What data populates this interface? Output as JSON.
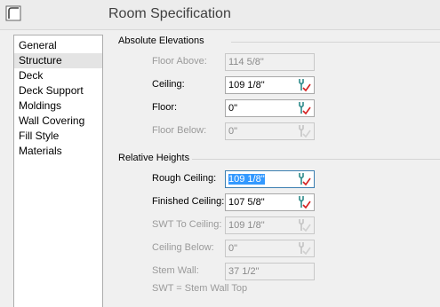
{
  "window": {
    "title": "Room Specification"
  },
  "nav": {
    "items": [
      {
        "label": "General",
        "selected": false
      },
      {
        "label": "Structure",
        "selected": true
      },
      {
        "label": "Deck",
        "selected": false
      },
      {
        "label": "Deck Support",
        "selected": false
      },
      {
        "label": "Moldings",
        "selected": false
      },
      {
        "label": "Wall Covering",
        "selected": false
      },
      {
        "label": "Fill Style",
        "selected": false
      },
      {
        "label": "Materials",
        "selected": false
      }
    ]
  },
  "absolute": {
    "title": "Absolute Elevations",
    "floor_above": {
      "label": "Floor Above:",
      "value": "114 5/8\""
    },
    "ceiling": {
      "label": "Ceiling:",
      "value": "109 1/8\""
    },
    "floor": {
      "label": "Floor:",
      "value": "0\""
    },
    "floor_below": {
      "label": "Floor Below:",
      "value": "0\""
    }
  },
  "relative": {
    "title": "Relative Heights",
    "rough_ceiling": {
      "label": "Rough Ceiling:",
      "value": "109 1/8\""
    },
    "finished_ceiling": {
      "label": "Finished Ceiling:",
      "value": "107 5/8\""
    },
    "swt_to_ceiling": {
      "label": "SWT To Ceiling:",
      "value": "109 1/8\""
    },
    "ceiling_below": {
      "label": "Ceiling Below:",
      "value": "0\""
    },
    "stem_wall": {
      "label": "Stem Wall:",
      "value": "37 1/2\""
    },
    "footnote": "SWT = Stem Wall Top"
  },
  "icons": {
    "window_icon": "room-icon",
    "field_icon": "wrench-check-icon"
  },
  "colors": {
    "selection": "#3399ff",
    "wrench_teal": "#2e8b8b",
    "check_red": "#d42020",
    "disabled_text": "#9a9a9a"
  }
}
